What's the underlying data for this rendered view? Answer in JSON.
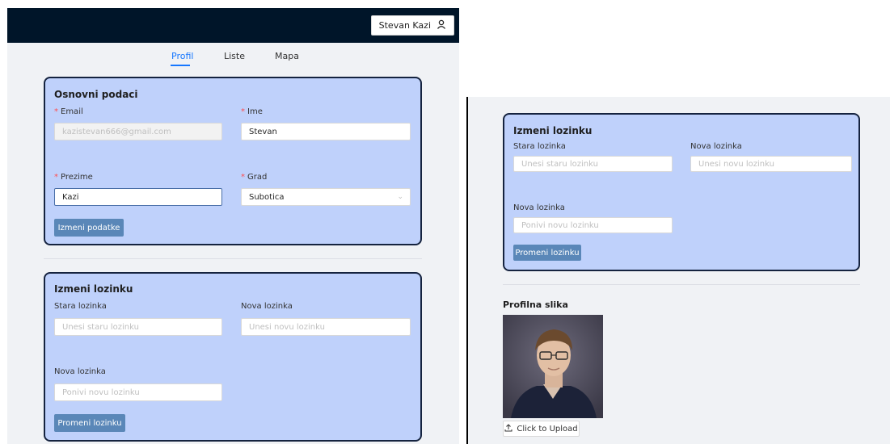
{
  "header": {
    "user_name": "Stevan Kazi"
  },
  "tabs": [
    {
      "label": "Profil"
    },
    {
      "label": "Liste"
    },
    {
      "label": "Mapa"
    }
  ],
  "basic_info": {
    "title": "Osnovni podaci",
    "email_label": "Email",
    "email_value": "kazistevan666@gmail.com",
    "ime_label": "Ime",
    "ime_value": "Stevan",
    "prezime_label": "Prezime",
    "prezime_value": "Kazi",
    "grad_label": "Grad",
    "grad_value": "Subotica",
    "submit_label": "Izmeni podatke"
  },
  "password": {
    "title": "Izmeni lozinku",
    "old_label": "Stara lozinka",
    "old_placeholder": "Unesi staru lozinku",
    "new_label": "Nova lozinka",
    "new_placeholder": "Unesi novu lozinku",
    "repeat_label": "Nova lozinka",
    "repeat_placeholder": "Ponivi novu lozinku",
    "submit_label": "Promeni lozinku"
  },
  "profile_picture": {
    "title": "Profilna slika",
    "upload_label": "Click to Upload"
  },
  "colors": {
    "header_bg": "#001529",
    "card_bg": "#bfd1fb",
    "card_border": "#15233f",
    "button_bg": "#5a87b8",
    "accent": "#1677ff"
  }
}
